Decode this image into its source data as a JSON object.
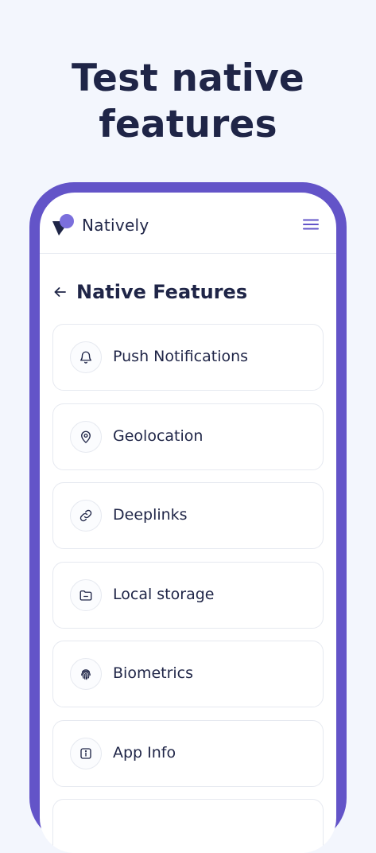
{
  "headline": {
    "line1": "Test native",
    "line2": "features"
  },
  "app": {
    "brand_name": "Natively",
    "accent_color": "#6354c8"
  },
  "page": {
    "title": "Native Features"
  },
  "features": [
    {
      "label": "Push Notifications",
      "icon": "bell-icon"
    },
    {
      "label": "Geolocation",
      "icon": "map-pin-icon"
    },
    {
      "label": "Deeplinks",
      "icon": "link-icon"
    },
    {
      "label": "Local storage",
      "icon": "folder-icon"
    },
    {
      "label": "Biometrics",
      "icon": "fingerprint-icon"
    },
    {
      "label": "App Info",
      "icon": "info-icon"
    }
  ]
}
